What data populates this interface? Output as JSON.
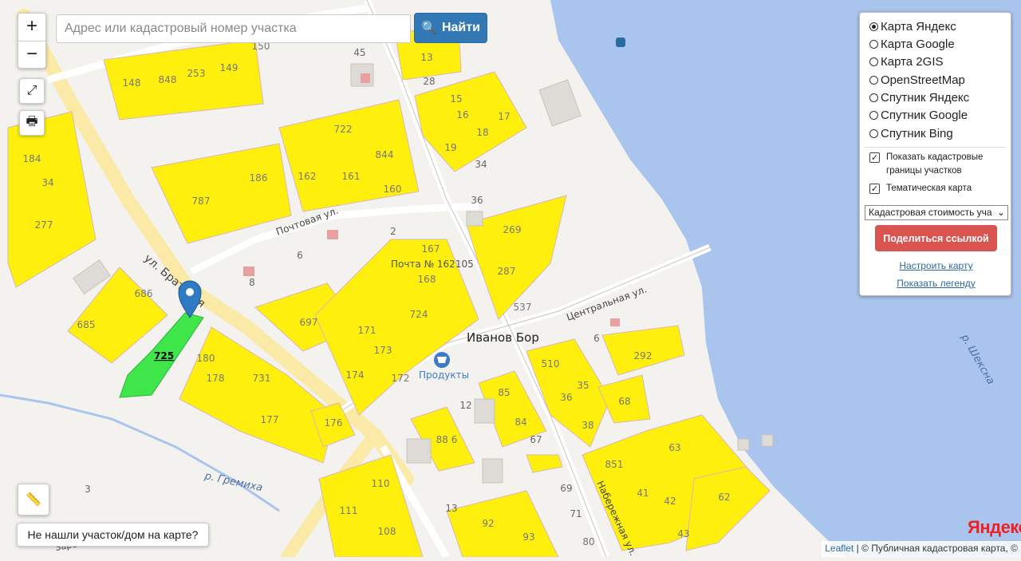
{
  "search": {
    "placeholder": "Адрес или кадастровый номер участка",
    "button_label": "Найти"
  },
  "zoom": {
    "in_label": "+",
    "out_label": "−"
  },
  "layers": {
    "basemaps": [
      {
        "label": "Карта Яндекс",
        "selected": true
      },
      {
        "label": "Карта Google",
        "selected": false
      },
      {
        "label": "Карта 2GIS",
        "selected": false
      },
      {
        "label": "OpenStreetMap",
        "selected": false
      },
      {
        "label": "Спутник Яндекс",
        "selected": false
      },
      {
        "label": "Спутник Google",
        "selected": false
      },
      {
        "label": "Спутник Bing",
        "selected": false
      }
    ],
    "show_borders_label": "Показать кадастровые границы участков",
    "thematic_label": "Тематическая карта",
    "thematic_select_value": "Кадастровая стоимость уча",
    "share_label": "Поделиться ссылкой",
    "configure_label": "Настроить карту",
    "legend_label": "Показать легенду"
  },
  "not_found_label": "Не нашли участок/дом на карте?",
  "attribution": {
    "leaflet": "Leaflet",
    "rest": " | © Публичная кадастровая карта, ©"
  },
  "yandex_logo": "Яндекс",
  "colors": {
    "parcel": "#fff000",
    "selected_parcel": "#3ee64a",
    "water": "#a9c5ee",
    "road": "#fbe9a8",
    "primary": "#3278b5",
    "danger": "#d9534f"
  },
  "map_labels": {
    "village": "Иванов Бор",
    "river_sheksna": "р. Шексна",
    "river_gremikha": "р. Гремиха",
    "street_pochtovaya": "Почтовая ул.",
    "street_bratskaya": "ул. Братская",
    "street_tsentralnaya": "Центральная ул.",
    "street_naberezhnaya": "Набережная ул.",
    "street_zarechnaya": "Заречная",
    "post_office": "Почта № 162105",
    "shop": "Продукты",
    "selected_parcel": "725"
  },
  "parcel_numbers": [
    "148",
    "848",
    "253",
    "149",
    "150",
    "13",
    "15",
    "16",
    "17",
    "18",
    "19",
    "184",
    "34",
    "277",
    "722",
    "787",
    "186",
    "162",
    "161",
    "844",
    "160",
    "269",
    "287",
    "537",
    "686",
    "685",
    "697",
    "171",
    "173",
    "174",
    "172",
    "724",
    "168",
    "167",
    "180",
    "178",
    "731",
    "177",
    "176",
    "510",
    "35",
    "36",
    "38",
    "68",
    "292",
    "85",
    "84",
    "88 6",
    "110",
    "111",
    "108",
    "92",
    "93",
    "80",
    "851",
    "41",
    "42",
    "43",
    "63",
    "62"
  ],
  "house_numbers": [
    "45",
    "28",
    "34",
    "36",
    "2",
    "6",
    "8",
    "6",
    "12",
    "67",
    "69",
    "71",
    "13",
    "3"
  ]
}
